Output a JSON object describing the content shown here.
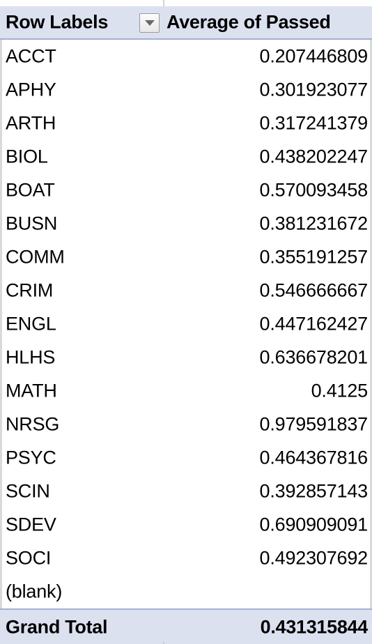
{
  "table": {
    "columns": {
      "row_labels_header": "Row Labels",
      "value_header": "Average of Passed",
      "filter_icon": "chevron-down-icon"
    },
    "rows": [
      {
        "label": "ACCT",
        "value": "0.207446809"
      },
      {
        "label": "APHY",
        "value": "0.301923077"
      },
      {
        "label": "ARTH",
        "value": "0.317241379"
      },
      {
        "label": "BIOL",
        "value": "0.438202247"
      },
      {
        "label": "BOAT",
        "value": "0.570093458"
      },
      {
        "label": "BUSN",
        "value": "0.381231672"
      },
      {
        "label": "COMM",
        "value": "0.355191257"
      },
      {
        "label": "CRIM",
        "value": "0.546666667"
      },
      {
        "label": "ENGL",
        "value": "0.447162427"
      },
      {
        "label": "HLHS",
        "value": "0.636678201"
      },
      {
        "label": "MATH",
        "value": "0.4125"
      },
      {
        "label": "NRSG",
        "value": "0.979591837"
      },
      {
        "label": "PSYC",
        "value": "0.464367816"
      },
      {
        "label": "SCIN",
        "value": "0.392857143"
      },
      {
        "label": "SDEV",
        "value": "0.690909091"
      },
      {
        "label": "SOCI",
        "value": "0.492307692"
      },
      {
        "label": "(blank)",
        "value": ""
      }
    ],
    "grand_total": {
      "label": "Grand Total",
      "value": "0.431315844"
    },
    "colors": {
      "header_background": "#dce1f0",
      "header_border": "#a3b0d4",
      "row_separator": "#d9d9d9",
      "text": "#000000",
      "body_background": "#ffffff"
    }
  }
}
